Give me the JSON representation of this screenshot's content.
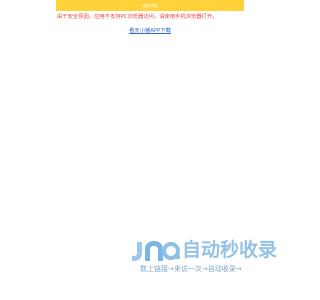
{
  "banner": {
    "label": "请在浏览"
  },
  "notice": {
    "warning": "由于安全原因，应用不支持PC浏览器访问，请使用手机浏览器打开。",
    "download_link": "看天小猪APP下载"
  },
  "logo": {
    "title": "自动秒收录",
    "subtitle": "数上链接→来访一次→自动收录→",
    "brand_color": "#94c2e6",
    "icon": "jn-logo-icon"
  }
}
